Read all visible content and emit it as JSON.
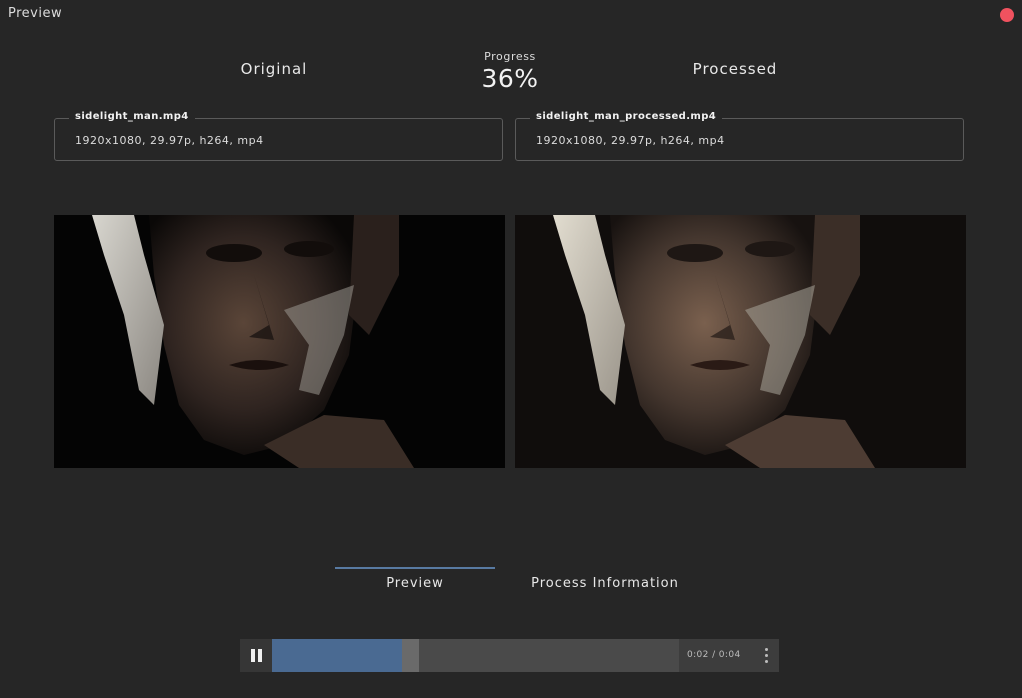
{
  "window": {
    "title": "Preview",
    "close_color": "#f0525f"
  },
  "header": {
    "original_label": "Original",
    "processed_label": "Processed",
    "progress_label": "Progress",
    "progress_value": "36%"
  },
  "files": {
    "original": {
      "name": "sidelight_man.mp4",
      "meta": "1920x1080, 29.97p, h264, mp4"
    },
    "processed": {
      "name": "sidelight_man_processed.mp4",
      "meta": "1920x1080, 29.97p, h264, mp4"
    }
  },
  "tabs": {
    "preview": "Preview",
    "process_information": "Process Information",
    "active": "preview"
  },
  "player": {
    "state": "playing",
    "played_fraction": 0.32,
    "buffered_fraction": 0.36,
    "time": "0:02 / 0:04",
    "accent": "#4a6a92"
  }
}
